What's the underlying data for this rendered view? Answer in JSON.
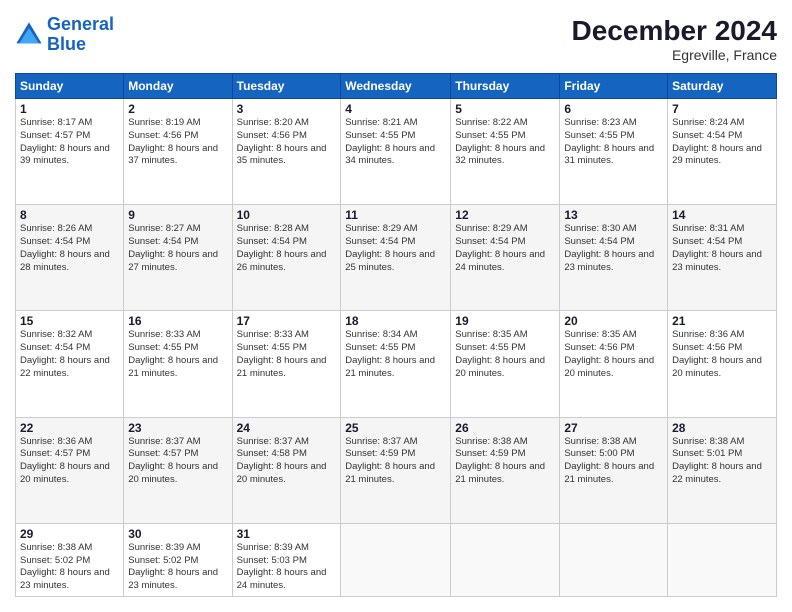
{
  "header": {
    "logo_line1": "General",
    "logo_line2": "Blue",
    "month": "December 2024",
    "location": "Egreville, France"
  },
  "weekdays": [
    "Sunday",
    "Monday",
    "Tuesday",
    "Wednesday",
    "Thursday",
    "Friday",
    "Saturday"
  ],
  "weeks": [
    [
      {
        "day": "1",
        "sunrise": "8:17 AM",
        "sunset": "4:57 PM",
        "daylight": "8 hours and 39 minutes."
      },
      {
        "day": "2",
        "sunrise": "8:19 AM",
        "sunset": "4:56 PM",
        "daylight": "8 hours and 37 minutes."
      },
      {
        "day": "3",
        "sunrise": "8:20 AM",
        "sunset": "4:56 PM",
        "daylight": "8 hours and 35 minutes."
      },
      {
        "day": "4",
        "sunrise": "8:21 AM",
        "sunset": "4:55 PM",
        "daylight": "8 hours and 34 minutes."
      },
      {
        "day": "5",
        "sunrise": "8:22 AM",
        "sunset": "4:55 PM",
        "daylight": "8 hours and 32 minutes."
      },
      {
        "day": "6",
        "sunrise": "8:23 AM",
        "sunset": "4:55 PM",
        "daylight": "8 hours and 31 minutes."
      },
      {
        "day": "7",
        "sunrise": "8:24 AM",
        "sunset": "4:54 PM",
        "daylight": "8 hours and 29 minutes."
      }
    ],
    [
      {
        "day": "8",
        "sunrise": "8:26 AM",
        "sunset": "4:54 PM",
        "daylight": "8 hours and 28 minutes."
      },
      {
        "day": "9",
        "sunrise": "8:27 AM",
        "sunset": "4:54 PM",
        "daylight": "8 hours and 27 minutes."
      },
      {
        "day": "10",
        "sunrise": "8:28 AM",
        "sunset": "4:54 PM",
        "daylight": "8 hours and 26 minutes."
      },
      {
        "day": "11",
        "sunrise": "8:29 AM",
        "sunset": "4:54 PM",
        "daylight": "8 hours and 25 minutes."
      },
      {
        "day": "12",
        "sunrise": "8:29 AM",
        "sunset": "4:54 PM",
        "daylight": "8 hours and 24 minutes."
      },
      {
        "day": "13",
        "sunrise": "8:30 AM",
        "sunset": "4:54 PM",
        "daylight": "8 hours and 23 minutes."
      },
      {
        "day": "14",
        "sunrise": "8:31 AM",
        "sunset": "4:54 PM",
        "daylight": "8 hours and 23 minutes."
      }
    ],
    [
      {
        "day": "15",
        "sunrise": "8:32 AM",
        "sunset": "4:54 PM",
        "daylight": "8 hours and 22 minutes."
      },
      {
        "day": "16",
        "sunrise": "8:33 AM",
        "sunset": "4:55 PM",
        "daylight": "8 hours and 21 minutes."
      },
      {
        "day": "17",
        "sunrise": "8:33 AM",
        "sunset": "4:55 PM",
        "daylight": "8 hours and 21 minutes."
      },
      {
        "day": "18",
        "sunrise": "8:34 AM",
        "sunset": "4:55 PM",
        "daylight": "8 hours and 21 minutes."
      },
      {
        "day": "19",
        "sunrise": "8:35 AM",
        "sunset": "4:55 PM",
        "daylight": "8 hours and 20 minutes."
      },
      {
        "day": "20",
        "sunrise": "8:35 AM",
        "sunset": "4:56 PM",
        "daylight": "8 hours and 20 minutes."
      },
      {
        "day": "21",
        "sunrise": "8:36 AM",
        "sunset": "4:56 PM",
        "daylight": "8 hours and 20 minutes."
      }
    ],
    [
      {
        "day": "22",
        "sunrise": "8:36 AM",
        "sunset": "4:57 PM",
        "daylight": "8 hours and 20 minutes."
      },
      {
        "day": "23",
        "sunrise": "8:37 AM",
        "sunset": "4:57 PM",
        "daylight": "8 hours and 20 minutes."
      },
      {
        "day": "24",
        "sunrise": "8:37 AM",
        "sunset": "4:58 PM",
        "daylight": "8 hours and 20 minutes."
      },
      {
        "day": "25",
        "sunrise": "8:37 AM",
        "sunset": "4:59 PM",
        "daylight": "8 hours and 21 minutes."
      },
      {
        "day": "26",
        "sunrise": "8:38 AM",
        "sunset": "4:59 PM",
        "daylight": "8 hours and 21 minutes."
      },
      {
        "day": "27",
        "sunrise": "8:38 AM",
        "sunset": "5:00 PM",
        "daylight": "8 hours and 21 minutes."
      },
      {
        "day": "28",
        "sunrise": "8:38 AM",
        "sunset": "5:01 PM",
        "daylight": "8 hours and 22 minutes."
      }
    ],
    [
      {
        "day": "29",
        "sunrise": "8:38 AM",
        "sunset": "5:02 PM",
        "daylight": "8 hours and 23 minutes."
      },
      {
        "day": "30",
        "sunrise": "8:39 AM",
        "sunset": "5:02 PM",
        "daylight": "8 hours and 23 minutes."
      },
      {
        "day": "31",
        "sunrise": "8:39 AM",
        "sunset": "5:03 PM",
        "daylight": "8 hours and 24 minutes."
      },
      null,
      null,
      null,
      null
    ]
  ]
}
